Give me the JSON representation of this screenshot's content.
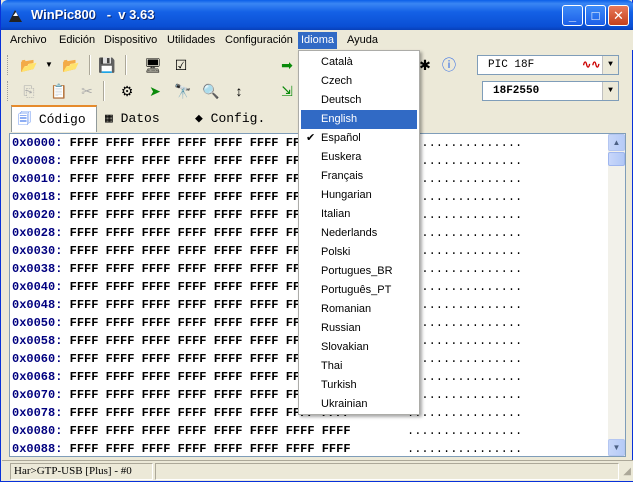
{
  "window": {
    "title": "WinPic800   -  v 3.63",
    "buttons": {
      "minimize": "_",
      "maximize": "□",
      "close": "✕"
    }
  },
  "menubar": {
    "items": [
      "Archivo",
      "Edición",
      "Dispositivo",
      "Utilidades",
      "Configuración",
      "Idioma",
      "Ayuda"
    ],
    "active": "Idioma"
  },
  "toolbar": {
    "device_family": "PIC 18F",
    "device_model": "18F2550"
  },
  "tabs": {
    "code": "Código",
    "data": "Datos",
    "config": "Config."
  },
  "hex_view": {
    "value": "FFFF",
    "rows": [
      {
        "addr": "0x0000:",
        "ascii": "................"
      },
      {
        "addr": "0x0008:",
        "ascii": "................"
      },
      {
        "addr": "0x0010:",
        "ascii": "................"
      },
      {
        "addr": "0x0018:",
        "ascii": "................"
      },
      {
        "addr": "0x0020:",
        "ascii": "................"
      },
      {
        "addr": "0x0028:",
        "ascii": "................"
      },
      {
        "addr": "0x0030:",
        "ascii": "................"
      },
      {
        "addr": "0x0038:",
        "ascii": "................"
      },
      {
        "addr": "0x0040:",
        "ascii": "................"
      },
      {
        "addr": "0x0048:",
        "ascii": "................"
      },
      {
        "addr": "0x0050:",
        "ascii": "................"
      },
      {
        "addr": "0x0058:",
        "ascii": "................"
      },
      {
        "addr": "0x0060:",
        "ascii": "................"
      },
      {
        "addr": "0x0068:",
        "ascii": "................"
      },
      {
        "addr": "0x0070:",
        "ascii": "................"
      },
      {
        "addr": "0x0078:",
        "ascii": "................"
      },
      {
        "addr": "0x0080:",
        "ascii": "................"
      },
      {
        "addr": "0x0088:",
        "ascii": "................"
      }
    ]
  },
  "language_menu": {
    "items": [
      "Català",
      "Czech",
      "Deutsch",
      "English",
      "Español",
      "Euskera",
      "Français",
      "Hungarian",
      "Italian",
      "Nederlands",
      "Polski",
      "Portugues_BR",
      "Português_PT",
      "Romanian",
      "Russian",
      "Slovakian",
      "Thai",
      "Turkish",
      "Ukrainian"
    ],
    "highlighted": "English",
    "checked": "Español"
  },
  "statusbar": {
    "hardware": "Har>GTP-USB [Plus] - #0"
  },
  "colors": {
    "title_blue": "#0a4fd4",
    "menu_highlight": "#316ac5",
    "address_blue": "#00007f"
  }
}
